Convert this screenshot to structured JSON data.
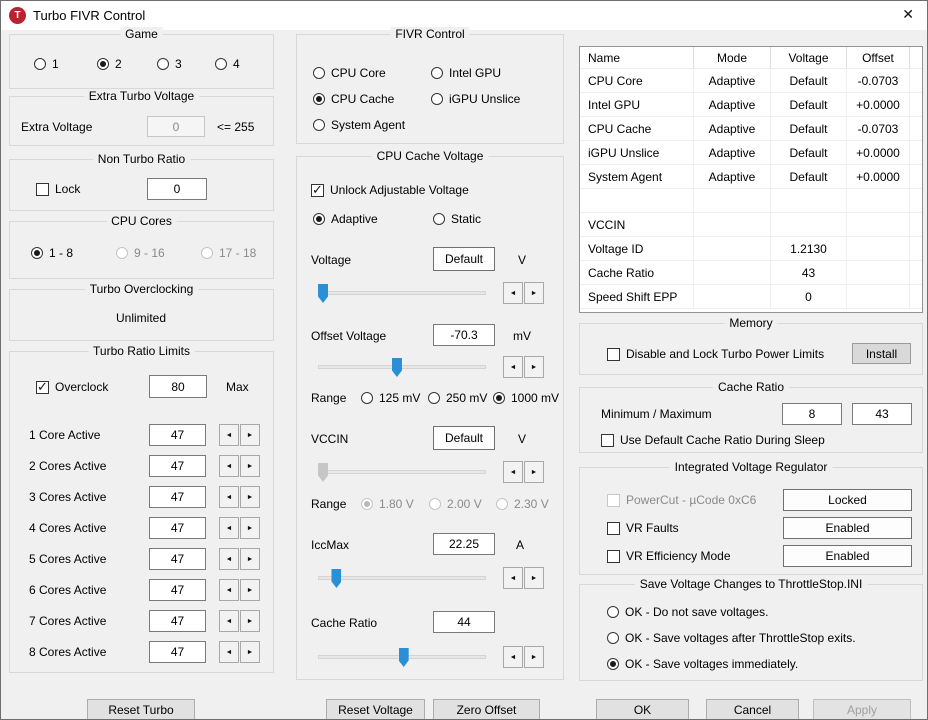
{
  "icons": {
    "close": "✕",
    "check": "✓",
    "spin_left": "◄",
    "spin_right": "►",
    "app_icon_letter": "T"
  },
  "window": {
    "title": "Turbo FIVR Control"
  },
  "left": {
    "game": {
      "title": "Game",
      "options": [
        {
          "label": "1",
          "selected": false
        },
        {
          "label": "2",
          "selected": true
        },
        {
          "label": "3",
          "selected": false
        },
        {
          "label": "4",
          "selected": false
        }
      ]
    },
    "extra_turbo_voltage": {
      "title": "Extra Turbo Voltage",
      "field_label": "Extra Voltage",
      "value": "0",
      "constraint": "<= 255"
    },
    "non_turbo_ratio": {
      "title": "Non Turbo Ratio",
      "lock_label": "Lock",
      "lock_checked": false,
      "value": "0"
    },
    "cpu_cores": {
      "title": "CPU Cores",
      "options": [
        {
          "label": "1 - 8",
          "selected": true,
          "disabled": false
        },
        {
          "label": "9 - 16",
          "selected": false,
          "disabled": true
        },
        {
          "label": "17 - 18",
          "selected": false,
          "disabled": true
        }
      ]
    },
    "turbo_overclocking": {
      "title": "Turbo Overclocking",
      "status": "Unlimited"
    },
    "turbo_ratio_limits": {
      "title": "Turbo Ratio Limits",
      "overclock_label": "Overclock",
      "overclock_checked": true,
      "max_value": "80",
      "max_label": "Max",
      "rows": [
        {
          "label": "1 Core Active",
          "value": "47"
        },
        {
          "label": "2 Cores Active",
          "value": "47"
        },
        {
          "label": "3 Cores Active",
          "value": "47"
        },
        {
          "label": "4 Cores Active",
          "value": "47"
        },
        {
          "label": "5 Cores Active",
          "value": "47"
        },
        {
          "label": "6 Cores Active",
          "value": "47"
        },
        {
          "label": "7 Cores Active",
          "value": "47"
        },
        {
          "label": "8 Cores Active",
          "value": "47"
        }
      ]
    }
  },
  "middle": {
    "fivr_control": {
      "title": "FIVR Control",
      "options": [
        {
          "label": "CPU Core",
          "selected": false
        },
        {
          "label": "CPU Cache",
          "selected": true
        },
        {
          "label": "System Agent",
          "selected": false
        },
        {
          "label": "Intel GPU",
          "selected": false
        },
        {
          "label": "iGPU Unslice",
          "selected": false
        }
      ]
    },
    "cpu_cache_voltage": {
      "title": "CPU Cache Voltage",
      "unlock_label": "Unlock Adjustable Voltage",
      "unlock_checked": true,
      "mode_options": [
        {
          "label": "Adaptive",
          "selected": true
        },
        {
          "label": "Static",
          "selected": false
        }
      ],
      "voltage": {
        "label": "Voltage",
        "value": "Default",
        "unit": "V"
      },
      "offset_voltage": {
        "label": "Offset Voltage",
        "value": "-70.3",
        "unit": "mV"
      },
      "offset_range": {
        "label": "Range",
        "options": [
          {
            "label": "125 mV",
            "selected": false
          },
          {
            "label": "250 mV",
            "selected": false
          },
          {
            "label": "1000 mV",
            "selected": true
          }
        ]
      },
      "vccin": {
        "label": "VCCIN",
        "value": "Default",
        "unit": "V"
      },
      "vccin_range": {
        "label": "Range",
        "options": [
          {
            "label": "1.80 V",
            "selected": true
          },
          {
            "label": "2.00 V",
            "selected": false
          },
          {
            "label": "2.30 V",
            "selected": false
          }
        ]
      },
      "iccmax": {
        "label": "IccMax",
        "value": "22.25",
        "unit": "A"
      },
      "cache_ratio": {
        "label": "Cache Ratio",
        "value": "44"
      }
    }
  },
  "right": {
    "table": {
      "headers": [
        "Name",
        "Mode",
        "Voltage",
        "Offset"
      ],
      "rows": [
        [
          "CPU Core",
          "Adaptive",
          "Default",
          "-0.0703"
        ],
        [
          "Intel GPU",
          "Adaptive",
          "Default",
          "+0.0000"
        ],
        [
          "CPU Cache",
          "Adaptive",
          "Default",
          "-0.0703"
        ],
        [
          "iGPU Unslice",
          "Adaptive",
          "Default",
          "+0.0000"
        ],
        [
          "System Agent",
          "Adaptive",
          "Default",
          "+0.0000"
        ],
        [
          "",
          "",
          "",
          ""
        ],
        [
          "VCCIN",
          "",
          "",
          ""
        ],
        [
          "Voltage ID",
          "",
          "1.2130",
          ""
        ],
        [
          "Cache Ratio",
          "",
          "43",
          ""
        ],
        [
          "Speed Shift EPP",
          "",
          "0",
          ""
        ]
      ]
    },
    "memory": {
      "title": "Memory",
      "checkbox_label": "Disable and Lock Turbo Power Limits",
      "checked": false,
      "install_button": "Install"
    },
    "cache_ratio": {
      "title": "Cache Ratio",
      "minmax_label": "Minimum / Maximum",
      "min_value": "8",
      "max_value": "43",
      "sleep_label": "Use Default Cache Ratio During Sleep",
      "sleep_checked": false
    },
    "ivr": {
      "title": "Integrated Voltage Regulator",
      "rows": [
        {
          "label": "PowerCut  -  µCode 0xC6",
          "button": "Locked",
          "disabled": true,
          "checked": false
        },
        {
          "label": "VR Faults",
          "button": "Enabled",
          "disabled": false,
          "checked": false
        },
        {
          "label": "VR Efficiency Mode",
          "button": "Enabled",
          "disabled": false,
          "checked": false
        }
      ]
    },
    "save": {
      "title": "Save Voltage Changes to ThrottleStop.INI",
      "options": [
        {
          "label": "OK - Do not save voltages.",
          "selected": false
        },
        {
          "label": "OK - Save voltages after ThrottleStop exits.",
          "selected": false
        },
        {
          "label": "OK - Save voltages immediately.",
          "selected": true
        }
      ]
    }
  },
  "footer": {
    "reset_turbo": "Reset Turbo",
    "reset_voltage": "Reset Voltage",
    "zero_offset": "Zero Offset",
    "ok": "OK",
    "cancel": "Cancel",
    "apply": "Apply"
  }
}
